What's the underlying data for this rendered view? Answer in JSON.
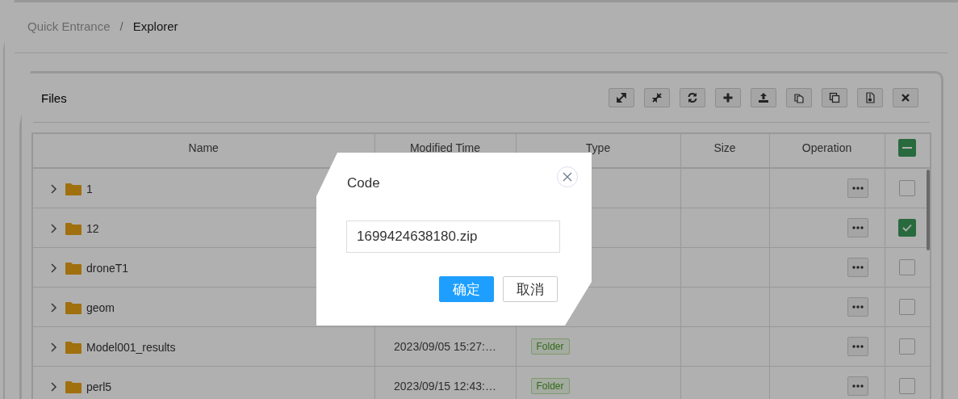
{
  "breadcrumb": [
    {
      "label": "Quick Entrance",
      "current": false
    },
    {
      "label": "Explorer",
      "current": true
    }
  ],
  "breadcrumb_separator": "/",
  "panel": {
    "title": "Files"
  },
  "table": {
    "columns": [
      "Name",
      "Modified Time",
      "Type",
      "Size",
      "Operation"
    ],
    "select_all": {
      "indeterminate": true
    },
    "rows": [
      {
        "name": "1",
        "checked": false
      },
      {
        "name": "12",
        "checked": true
      },
      {
        "name": "droneT1",
        "checked": false
      },
      {
        "name": "geom",
        "checked": false
      },
      {
        "name": "Model001_results",
        "modified": "2023/09/05 15:27:…",
        "type": "Folder",
        "checked": false
      },
      {
        "name": "perl5",
        "modified": "2023/09/15 12:43:…",
        "type": "Folder",
        "checked": false
      }
    ]
  },
  "dialog": {
    "title": "Code",
    "value": "1699424638180.zip",
    "buttons": [
      {
        "label": "确定",
        "kind": "primary"
      },
      {
        "label": "取消",
        "kind": "default"
      }
    ]
  }
}
